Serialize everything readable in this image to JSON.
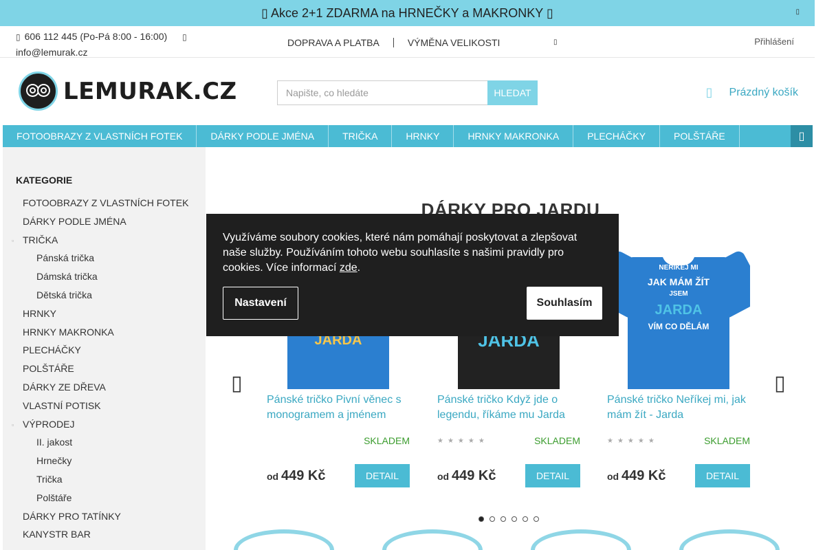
{
  "promo": {
    "text": "▯ Akce 2+1 ZDARMA na HRNEČKY a MAKRONKY ▯",
    "close_icon": "▯"
  },
  "topbar": {
    "phone": "606 112 445 (Po-Pá 8:00 - 16:00)",
    "email": "info@lemurak.cz",
    "links": [
      "DOPRAVA A PLATBA",
      "VÝMĚNA VELIKOSTI"
    ],
    "more_icon": "▯",
    "login": "Přihlášení"
  },
  "header": {
    "logo_text": "LEMURAK.CZ",
    "search_placeholder": "Napište, co hledáte",
    "search_button": "HLEDAT",
    "cart_icon": "▯",
    "cart_label": "Prázdný košík"
  },
  "nav": {
    "items": [
      "FOTOOBRAZY Z VLASTNÍCH FOTEK",
      "DÁRKY PODLE JMÉNA",
      "TRIČKA",
      "HRNKY",
      "HRNKY MAKRONKA",
      "PLECHÁČKY",
      "POLŠTÁŘE"
    ],
    "menu_icon": "▯"
  },
  "sidebar": {
    "title": "KATEGORIE",
    "items": [
      {
        "label": "FOTOOBRAZY Z VLASTNÍCH FOTEK",
        "level": 0
      },
      {
        "label": "DÁRKY PODLE JMÉNA",
        "level": 0
      },
      {
        "label": "TRIČKA",
        "level": 0
      },
      {
        "label": "Pánská trička",
        "level": 1
      },
      {
        "label": "Dámská trička",
        "level": 1
      },
      {
        "label": "Dětská trička",
        "level": 1
      },
      {
        "label": "HRNKY",
        "level": 0
      },
      {
        "label": "HRNKY MAKRONKA",
        "level": 0
      },
      {
        "label": "PLECHÁČKY",
        "level": 0
      },
      {
        "label": "POLŠTÁŘE",
        "level": 0
      },
      {
        "label": "DÁRKY ZE DŘEVA",
        "level": 0
      },
      {
        "label": "VLASTNÍ POTISK",
        "level": 0
      },
      {
        "label": "VÝPRODEJ",
        "level": 0
      },
      {
        "label": "II. jakost",
        "level": 1
      },
      {
        "label": "Hrnečky",
        "level": 1
      },
      {
        "label": "Trička",
        "level": 1
      },
      {
        "label": "Polštáře",
        "level": 1
      },
      {
        "label": "DÁRKY PRO TATÍNKY",
        "level": 0
      },
      {
        "label": "KANYSTR BAR",
        "level": 0
      }
    ]
  },
  "main": {
    "title": "DÁRKY PRO JARDU",
    "prev_icon": "▯",
    "next_icon": "▯",
    "products": [
      {
        "name": "Pánské tričko Pivní věnec s monogramem a jménem",
        "stock": "SKLADEM",
        "price_prefix": "od",
        "price": "449 Kč",
        "detail": "DETAIL",
        "color": "#2b7fd0",
        "print_lines": [
          "JARDA"
        ],
        "stars": ""
      },
      {
        "name": "Pánské tričko Když jde o legendu, říkáme mu Jarda",
        "stock": "SKLADEM",
        "price_prefix": "od",
        "price": "449 Kč",
        "detail": "DETAIL",
        "color": "#222222",
        "print_lines": [
          "JARDA"
        ],
        "stars": "★★★★★"
      },
      {
        "name": "Pánské tričko Neříkej mi, jak mám žít - Jarda",
        "stock": "SKLADEM",
        "price_prefix": "od",
        "price": "449 Kč",
        "detail": "DETAIL",
        "color": "#2b7fd0",
        "print_lines": [
          "NEŘÍKEJ MI",
          "JAK MÁM ŽÍT",
          "JSEM",
          "JARDA",
          "VÍM CO DĚLÁM"
        ],
        "stars": "★★★★★"
      }
    ],
    "slider_active": 0
  },
  "cookie": {
    "text": "Využíváme soubory cookies, které nám pomáhají poskytovat a zlepšovat naše služby. Používáním tohoto webu souhlasíte s našimi pravidly pro cookies. Více informací ",
    "link": "zde",
    "after_link": ".",
    "settings": "Nastavení",
    "agree": "Souhlasím"
  },
  "colors": {
    "accent": "#7fd4e6",
    "nav": "#4bbbd4",
    "link": "#3aa8c2",
    "stock": "#3b9c2e"
  }
}
